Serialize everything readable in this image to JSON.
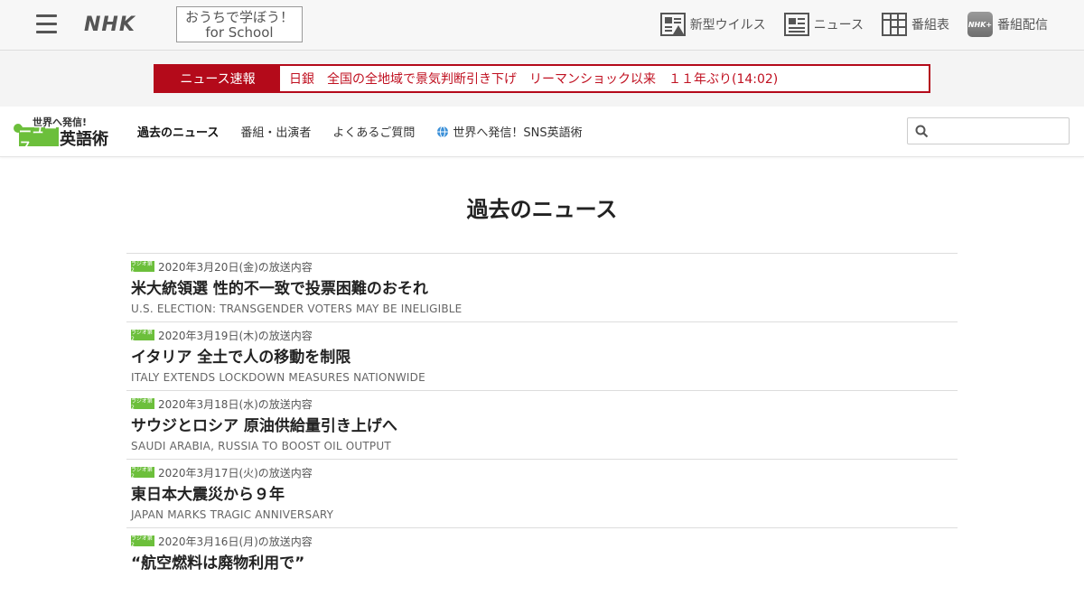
{
  "header": {
    "brand": "NHK",
    "school_line1": "おうちで学ぼう！",
    "school_line2": "for School",
    "nav": [
      {
        "label": "新型ウイルス",
        "icon": "virus-news-icon"
      },
      {
        "label": "ニュース",
        "icon": "newspaper-icon"
      },
      {
        "label": "番組表",
        "icon": "tv-grid-icon"
      },
      {
        "label": "番組配信",
        "icon": "nhk-plus-icon"
      }
    ],
    "nhk_badge": "NHK+"
  },
  "breaking": {
    "label": "ニュース速報",
    "text": "日銀　全国の全地域で景気判断引き下げ　リーマンショック以来　１１年ぶり(14:02)"
  },
  "program": {
    "logo_small": "世界へ発信!",
    "logo_box": "ニュース",
    "logo_big": "英語術",
    "nav": [
      {
        "label": "過去のニュース",
        "active": true
      },
      {
        "label": "番組・出演者",
        "active": false
      },
      {
        "label": "よくあるご質問",
        "active": false
      },
      {
        "label": "世界へ発信！SNS英語術",
        "active": false
      }
    ],
    "search_placeholder": ""
  },
  "main": {
    "title": "過去のニュース",
    "radio_badge": "ラジオ第2",
    "items": [
      {
        "date": "2020年3月20日(金)の放送内容",
        "title_jp": "米大統領選 性的不一致で投票困難のおそれ",
        "title_en": "U.S. ELECTION: TRANSGENDER VOTERS MAY BE INELIGIBLE"
      },
      {
        "date": "2020年3月19日(木)の放送内容",
        "title_jp": "イタリア 全土で人の移動を制限",
        "title_en": "ITALY EXTENDS LOCKDOWN MEASURES NATIONWIDE"
      },
      {
        "date": "2020年3月18日(水)の放送内容",
        "title_jp": "サウジとロシア 原油供給量引き上げへ",
        "title_en": "SAUDI ARABIA, RUSSIA TO BOOST OIL OUTPUT"
      },
      {
        "date": "2020年3月17日(火)の放送内容",
        "title_jp": "東日本大震災から９年",
        "title_en": "JAPAN MARKS TRAGIC ANNIVERSARY"
      },
      {
        "date": "2020年3月16日(月)の放送内容",
        "title_jp": "“航空燃料は廃物利用で”",
        "title_en": ""
      }
    ]
  }
}
